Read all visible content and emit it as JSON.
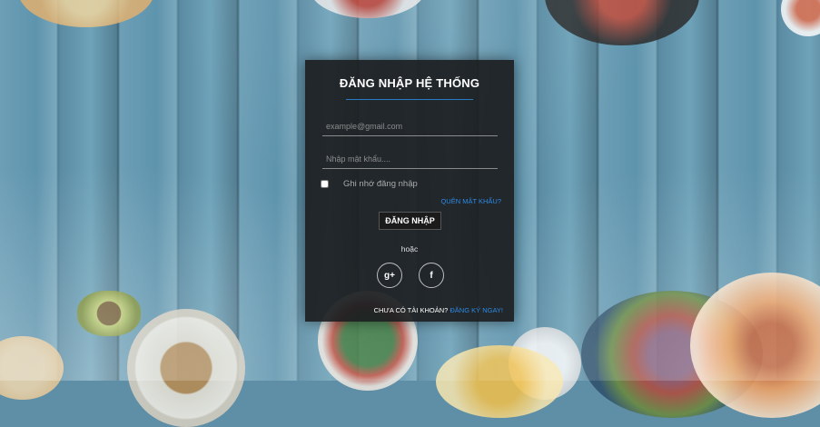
{
  "login": {
    "title": "ĐĂNG NHẬP HỆ THỐNG",
    "email_placeholder": "example@gmail.com",
    "password_placeholder": "Nhập mật khẩu....",
    "remember_label": "Ghi nhớ đăng nhập",
    "forgot_link": "QUÊN MẬT KHẨU?",
    "submit_label": "ĐĂNG NHẬP",
    "or_text": "hoặc",
    "social": {
      "google_icon": "google-plus-icon",
      "google_glyph": "g+",
      "facebook_icon": "facebook-icon",
      "facebook_glyph": "f"
    },
    "no_account_text": "CHƯA CÓ TÀI KHOẢN?",
    "signup_link": "ĐĂNG KÝ NGAY!"
  },
  "colors": {
    "accent": "#2d8ae6",
    "panel": "#1c1e20"
  }
}
